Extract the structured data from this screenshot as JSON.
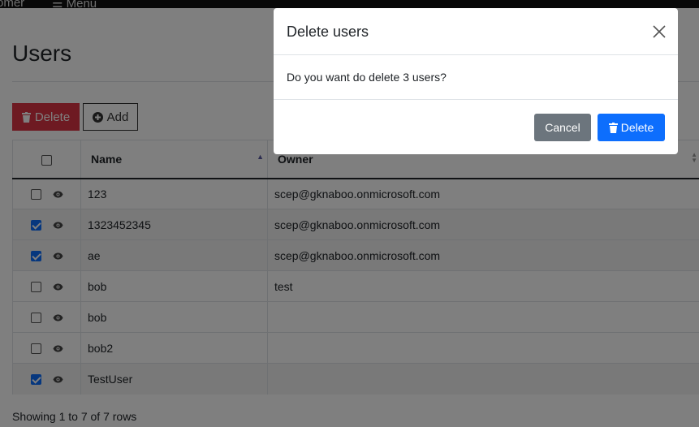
{
  "topbar": {
    "brand": "omer",
    "menu_label": "Menu"
  },
  "page": {
    "title": "Users"
  },
  "toolbar": {
    "delete_label": "Delete",
    "add_label": "Add"
  },
  "table": {
    "headers": {
      "name": "Name",
      "owner": "Owner"
    },
    "rows": [
      {
        "name": "123",
        "owner": "scep@gknaboo.onmicrosoft.com",
        "checked": false
      },
      {
        "name": "1323452345",
        "owner": "scep@gknaboo.onmicrosoft.com",
        "checked": true
      },
      {
        "name": "ae",
        "owner": "scep@gknaboo.onmicrosoft.com",
        "checked": true
      },
      {
        "name": "bob",
        "owner": "test",
        "checked": false
      },
      {
        "name": "bob",
        "owner": "",
        "checked": false
      },
      {
        "name": "bob2",
        "owner": "",
        "checked": false
      },
      {
        "name": "TestUser",
        "owner": "",
        "checked": true
      }
    ]
  },
  "pagination": {
    "info": "Showing 1 to 7 of 7 rows"
  },
  "modal": {
    "title": "Delete users",
    "message": "Do you want do delete 3 users?",
    "cancel_label": "Cancel",
    "confirm_label": "Delete"
  },
  "colors": {
    "danger": "#dc3545",
    "primary": "#0d6efd",
    "secondary": "#6c757d"
  }
}
